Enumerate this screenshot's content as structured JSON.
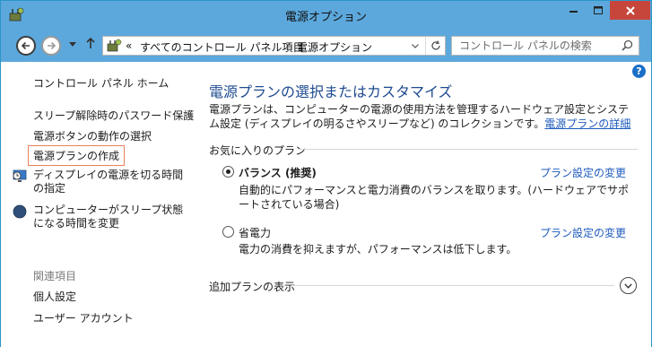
{
  "window": {
    "title": "電源オプション",
    "icon": "power-options-icon"
  },
  "nav": {
    "back_icon": "back-arrow-icon",
    "forward_icon": "forward-arrow-icon",
    "up_icon": "up-arrow-icon"
  },
  "address": {
    "prefix": "«",
    "crumbs": [
      "すべてのコントロール パネル項目",
      "電源オプション"
    ],
    "separator": "›"
  },
  "search": {
    "placeholder": "コントロール パネルの検索"
  },
  "sidebar": {
    "home": "コントロール パネル ホーム",
    "items": [
      "スリープ解除時のパスワード保護",
      "電源ボタンの動作の選択",
      "電源プランの作成",
      "ディスプレイの電源を切る時間の指定",
      "コンピューターがスリープ状態になる時間を変更"
    ],
    "related_header": "関連項目",
    "related": [
      "個人設定",
      "ユーザー アカウント"
    ]
  },
  "main": {
    "heading": "電源プランの選択またはカスタマイズ",
    "description": "電源プランは、コンピューターの電源の使用方法を管理するハードウェア設定とシステム設定 (ディスプレイの明るさやスリープなど) のコレクションです。",
    "description_link": "電源プランの詳細",
    "favorites_label": "お気に入りのプラン",
    "plans": [
      {
        "name": "バランス (推奨)",
        "selected": true,
        "description": "自動的にパフォーマンスと電力消費のバランスを取ります。(ハードウェアでサポートされている場合)",
        "link": "プラン設定の変更"
      },
      {
        "name": "省電力",
        "selected": false,
        "description": "電力の消費を抑えますが、パフォーマンスは低下します。",
        "link": "プラン設定の変更"
      }
    ],
    "additional_label": "追加プランの表示"
  },
  "colors": {
    "titlebar": "#5ca8dc",
    "close": "#c7463c",
    "heading": "#1e4b8f",
    "link": "#1e5bbd",
    "highlight_border": "#e8825a"
  }
}
